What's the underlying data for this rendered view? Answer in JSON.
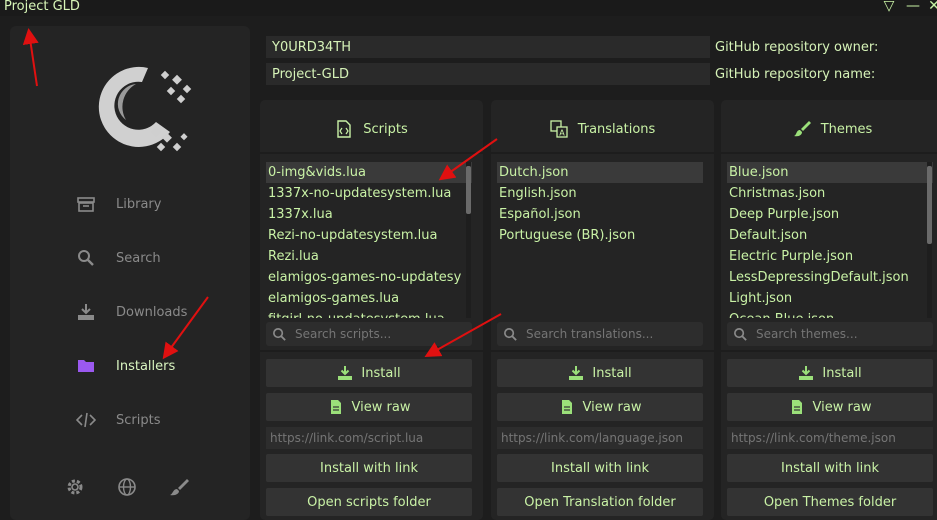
{
  "window": {
    "title": "Project GLD",
    "controls": [
      "▽",
      "—",
      "✕"
    ]
  },
  "sidebar": {
    "items": [
      {
        "label": "Library",
        "icon": "archive-icon",
        "active": false
      },
      {
        "label": "Search",
        "icon": "search-icon",
        "active": false
      },
      {
        "label": "Downloads",
        "icon": "download-icon",
        "active": false
      },
      {
        "label": "Installers",
        "icon": "folder-icon",
        "active": true
      },
      {
        "label": "Scripts",
        "icon": "code-icon",
        "active": false
      }
    ],
    "bottom_icons": [
      "gear-icon",
      "globe-icon",
      "brush-icon"
    ]
  },
  "repo": {
    "owner_value": "Y0URD34TH",
    "owner_label": "GitHub repository owner:",
    "name_value": "Project-GLD",
    "name_label": "GitHub repository name:"
  },
  "panels": {
    "scripts": {
      "title": "Scripts",
      "icon": "file-code-icon",
      "items": [
        "0-img&vids.lua",
        "1337x-no-updatesystem.lua",
        "1337x.lua",
        "Rezi-no-updatesystem.lua",
        "Rezi.lua",
        "elamigos-games-no-updatesy",
        "elamigos-games.lua",
        "fitgirl-no-updatesystem.lua"
      ],
      "search_placeholder": "Search scripts...",
      "install": "Install",
      "view_raw": "View raw",
      "link_placeholder": "https://link.com/script.lua",
      "install_link": "Install with link",
      "open_folder": "Open scripts folder"
    },
    "translations": {
      "title": "Translations",
      "icon": "translate-icon",
      "items": [
        "Dutch.json",
        "English.json",
        "Español.json",
        "Portuguese (BR).json"
      ],
      "search_placeholder": "Search translations...",
      "install": "Install",
      "view_raw": "View raw",
      "link_placeholder": "https://link.com/language.json",
      "install_link": "Install with link",
      "open_folder": "Open Translation folder"
    },
    "themes": {
      "title": "Themes",
      "icon": "brush-icon",
      "items": [
        "Blue.json",
        "Christmas.json",
        "Deep Purple.json",
        "Default.json",
        "Electric Purple.json",
        "LessDepressingDefault.json",
        "Light.json",
        "Ocean Blue.json"
      ],
      "search_placeholder": "Search themes...",
      "install": "Install",
      "view_raw": "View raw",
      "link_placeholder": "https://link.com/theme.json",
      "install_link": "Install with link",
      "open_folder": "Open Themes folder"
    }
  },
  "colors": {
    "accent_text": "#c9f2a6",
    "active_icon": "#9b59f0",
    "annotation_arrow": "#e01010"
  }
}
